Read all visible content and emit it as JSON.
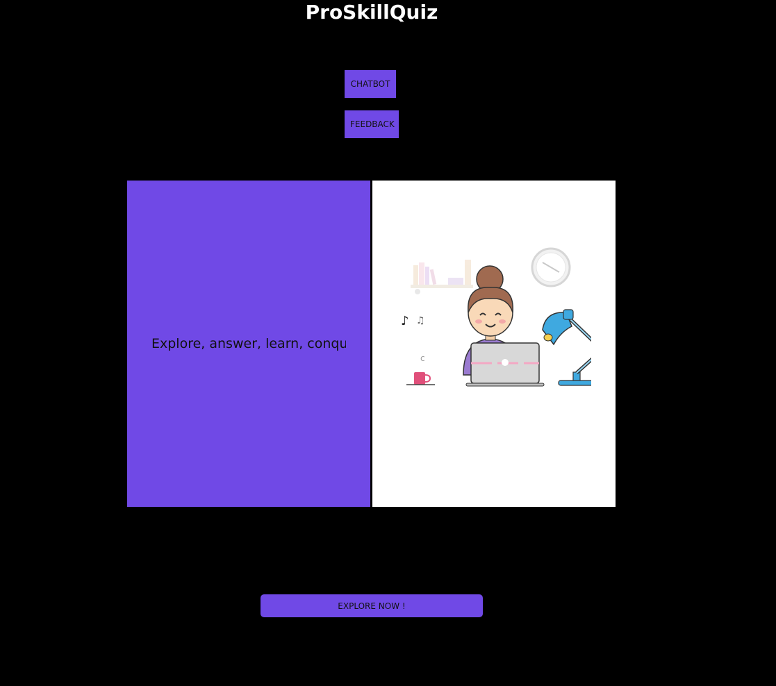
{
  "header": {
    "title": "ProSkillQuiz"
  },
  "nav": {
    "chatbot_label": "CHATBOT",
    "feedback_label": "FEEDBACK"
  },
  "hero": {
    "tagline": "Explore, answer, learn, conque",
    "illustration_icon": "woman-studying-at-laptop-illustration"
  },
  "cta": {
    "explore_label": "EXPLORE NOW !"
  },
  "colors": {
    "background": "#000000",
    "accent": "#7049e6",
    "panel": "#ffffff",
    "title_text": "#ffffff"
  }
}
